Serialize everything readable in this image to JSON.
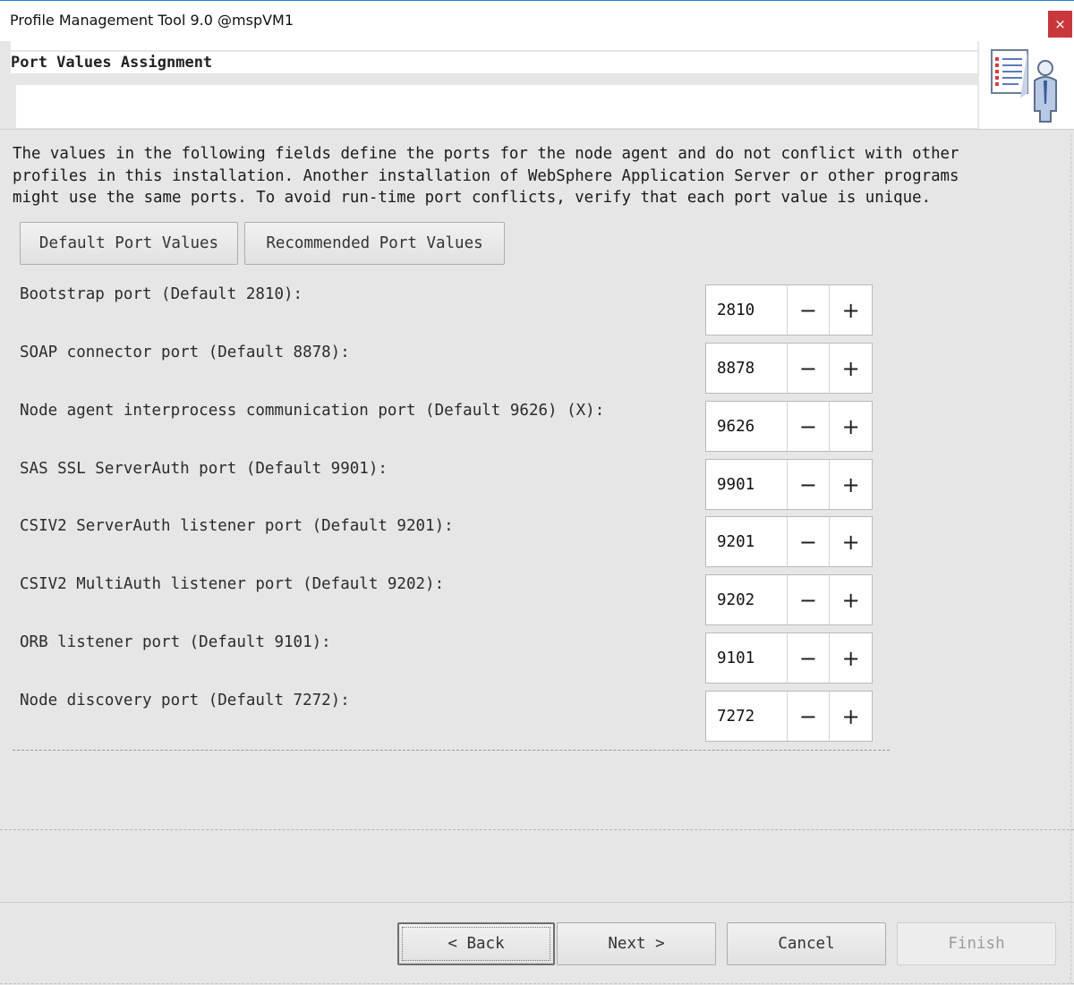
{
  "window": {
    "title": "Profile Management Tool 9.0 @mspVM1",
    "close_label": "×"
  },
  "page": {
    "title": "Port Values Assignment",
    "description": "The values in the following fields define the ports for the node agent and do not conflict with other\nprofiles in this installation. Another installation of WebSphere Application Server or other programs\nmight use the same ports. To avoid run-time port conflicts, verify that each port value is unique."
  },
  "preset_buttons": {
    "default_label": "Default Port Values",
    "recommended_label": "Recommended Port Values"
  },
  "ports": [
    {
      "label": "Bootstrap port (Default 2810):",
      "value": "2810"
    },
    {
      "label": "SOAP connector port (Default 8878):",
      "value": "8878"
    },
    {
      "label": "Node agent interprocess communication port (Default 9626) (X):",
      "value": "9626"
    },
    {
      "label": "SAS SSL ServerAuth port (Default 9901):",
      "value": "9901"
    },
    {
      "label": "CSIV2 ServerAuth listener port (Default 9201):",
      "value": "9201"
    },
    {
      "label": "CSIV2 MultiAuth listener port (Default 9202):",
      "value": "9202"
    },
    {
      "label": "ORB listener port (Default 9101):",
      "value": "9101"
    },
    {
      "label": "Node discovery port (Default 7272):",
      "value": "7272"
    }
  ],
  "spinner": {
    "minus": "−",
    "plus": "+"
  },
  "footer": {
    "back_label": "< Back",
    "next_label": "Next >",
    "cancel_label": "Cancel",
    "finish_label": "Finish"
  }
}
